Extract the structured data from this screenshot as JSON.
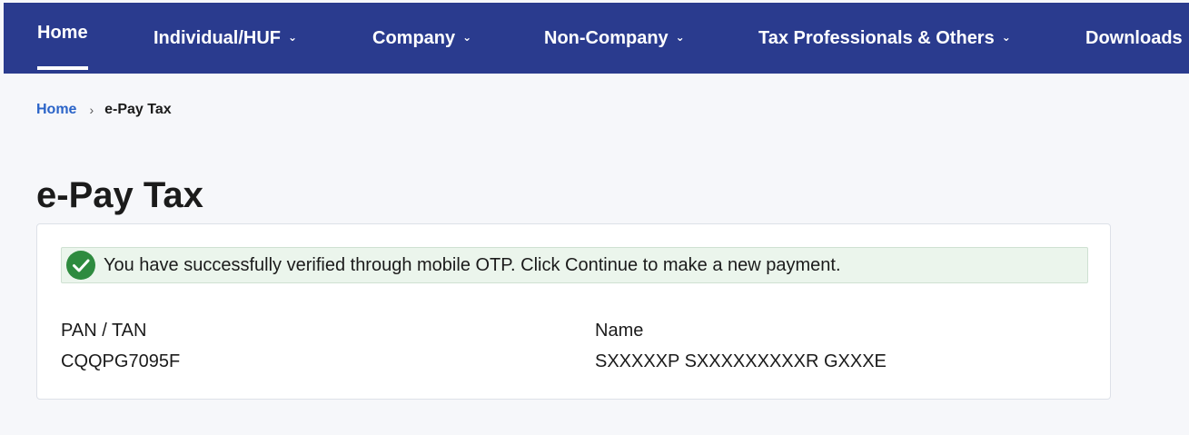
{
  "nav": {
    "items": [
      {
        "label": "Home",
        "has_dropdown": false,
        "active": true
      },
      {
        "label": "Individual/HUF",
        "has_dropdown": true
      },
      {
        "label": "Company",
        "has_dropdown": true
      },
      {
        "label": "Non-Company",
        "has_dropdown": true
      },
      {
        "label": "Tax Professionals & Others",
        "has_dropdown": true
      },
      {
        "label": "Downloads",
        "has_dropdown": false
      }
    ],
    "chevron_glyph": "⌄",
    "background_color": "#2a3b8e"
  },
  "breadcrumb": {
    "home": "Home",
    "separator": "›",
    "current": "e-Pay Tax"
  },
  "page_title": "e-Pay Tax",
  "alert": {
    "type": "success",
    "icon": "check-circle-icon",
    "message": "You have successfully verified through mobile OTP. Click Continue to make a new payment.",
    "icon_color": "#2e8b3f"
  },
  "details": {
    "pan_label": "PAN / TAN",
    "pan_value": "CQQPG7095F",
    "name_label": "Name",
    "name_value": "SXXXXXP SXXXXXXXXXR GXXXE"
  }
}
